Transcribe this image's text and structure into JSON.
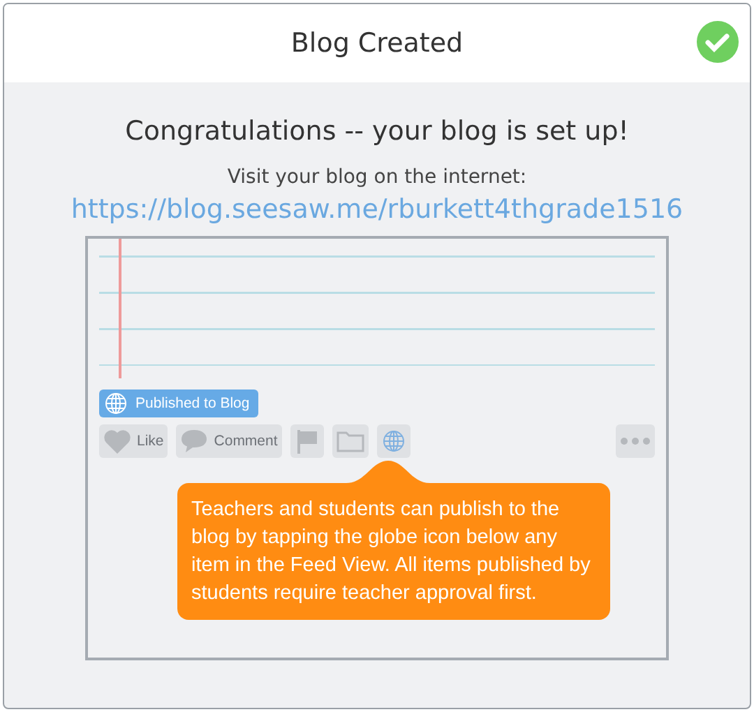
{
  "dialog": {
    "title": "Blog Created"
  },
  "message": {
    "heading": "Congratulations -- your blog is set up!",
    "visit_label": "Visit your blog on the internet:",
    "link": "https://blog.seesaw.me/rburkett4thgrade1516"
  },
  "illustration": {
    "badge": "Published to Blog",
    "actions": [
      {
        "kind": "like",
        "label": "Like"
      },
      {
        "kind": "comment",
        "label": "Comment"
      },
      {
        "kind": "flag"
      },
      {
        "kind": "folder"
      },
      {
        "kind": "globe"
      },
      {
        "kind": "more"
      }
    ],
    "tooltip": "Teachers and students can publish to the blog by tapping the globe icon below any item in the Feed View. All items published by students require teacher approval first."
  }
}
